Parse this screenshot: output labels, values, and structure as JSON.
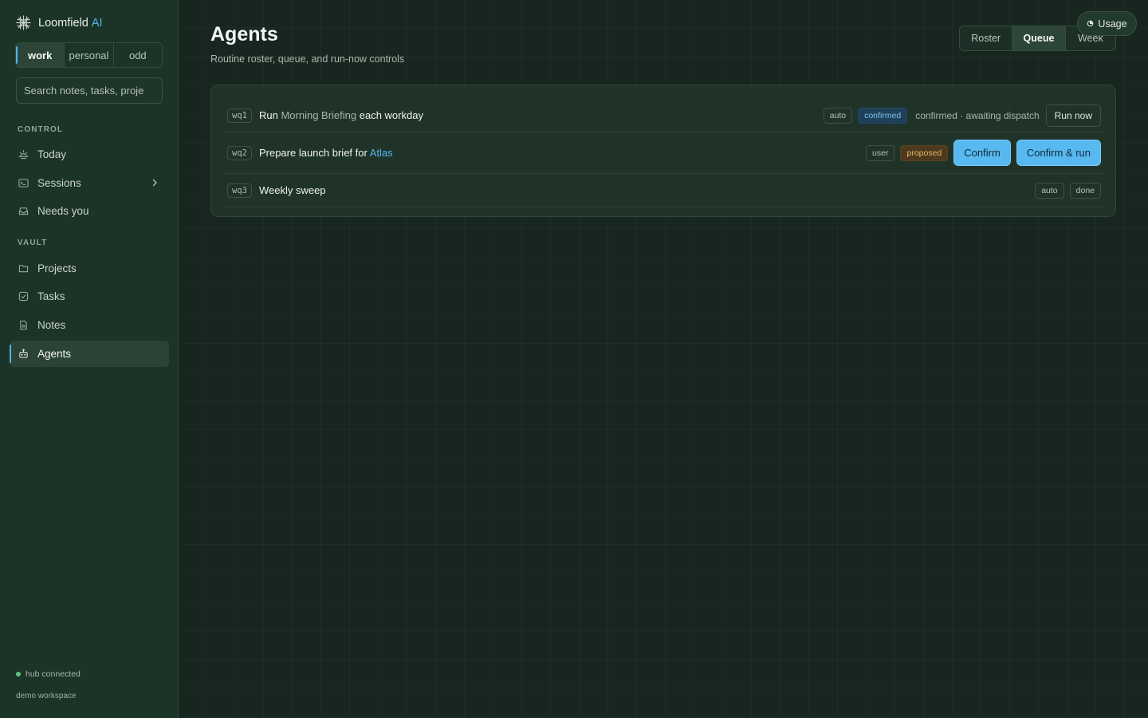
{
  "brand": {
    "name": "Loomfield",
    "suffix": "AI"
  },
  "workspaces": [
    "work",
    "personal",
    "odd"
  ],
  "active_workspace": "work",
  "search": {
    "placeholder": "Search notes, tasks, proje"
  },
  "sidebar": {
    "control_label": "CONTROL",
    "control_items": [
      {
        "label": "Today",
        "icon": "sun-icon"
      },
      {
        "label": "Sessions",
        "icon": "terminal-icon"
      },
      {
        "label": "Needs you",
        "icon": "inbox-icon"
      }
    ],
    "vault_label": "VAULT",
    "vault_items": [
      {
        "label": "Projects",
        "icon": "folder-icon"
      },
      {
        "label": "Tasks",
        "icon": "checkbox-icon"
      },
      {
        "label": "Notes",
        "icon": "document-icon"
      },
      {
        "label": "Agents",
        "icon": "robot-icon"
      }
    ],
    "active_item": "Agents",
    "status": "hub connected",
    "footer": "demo workspace"
  },
  "page": {
    "title": "Agents",
    "subtitle": "Routine roster, queue, and run-now controls"
  },
  "usage_label": "Usage",
  "view_tabs": [
    "Roster",
    "Queue",
    "Week"
  ],
  "active_view": "Queue",
  "queue": [
    {
      "id": "wq1",
      "title_prefix": "Run",
      "title_ref": "Morning Briefing",
      "title_suffix": "each workday",
      "source": "auto",
      "state": "confirmed",
      "note": "confirmed · awaiting dispatch",
      "action": "Run now"
    },
    {
      "id": "wq2",
      "title_prefix": "Prepare launch brief for",
      "title_ref": "Atlas",
      "source": "user",
      "state": "proposed",
      "actions": [
        "Confirm",
        "Confirm & run"
      ]
    },
    {
      "id": "wq3",
      "title": "Weekly sweep",
      "source": "auto",
      "state": "done"
    }
  ],
  "colors": {
    "accent": "#52b4f0",
    "sidebar_bg": "#1c3327",
    "main_bg": "#172720",
    "proposed": "#e3b46c",
    "online": "#5fbf7f"
  }
}
